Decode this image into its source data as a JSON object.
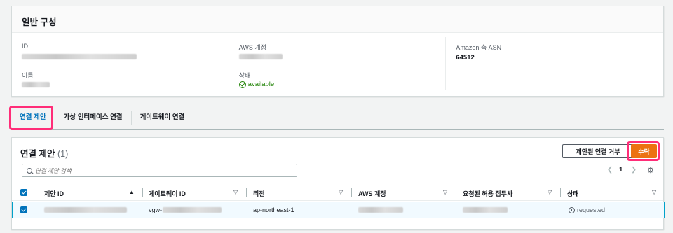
{
  "general": {
    "title": "일반 구성",
    "id_label": "ID",
    "name_label": "이름",
    "aws_account_label": "AWS 계정",
    "state_label": "상태",
    "state_value": "available",
    "asn_label": "Amazon 측 ASN",
    "asn_value": "64512"
  },
  "tabs": [
    {
      "label": "연결 제안",
      "active": true
    },
    {
      "label": "가상 인터페이스 연결",
      "active": false
    },
    {
      "label": "게이트웨이 연결",
      "active": false
    }
  ],
  "proposals": {
    "title": "연결 제안",
    "count": "(1)",
    "reject_button": "제안된 연결 거부",
    "accept_button": "수락",
    "search_placeholder": "연결 제안 검색",
    "page": "1",
    "columns": [
      "제안 ID",
      "게이트웨이 ID",
      "리전",
      "AWS 계정",
      "요청된 허용 접두사",
      "상태"
    ],
    "rows": [
      {
        "gateway_prefix": "vgw-",
        "region": "ap-northeast-1",
        "status": "requested"
      }
    ]
  },
  "colors": {
    "accent": "#0073bb",
    "primary_button": "#ec7211",
    "highlight": "#ff2d78",
    "ok": "#1d8102"
  }
}
